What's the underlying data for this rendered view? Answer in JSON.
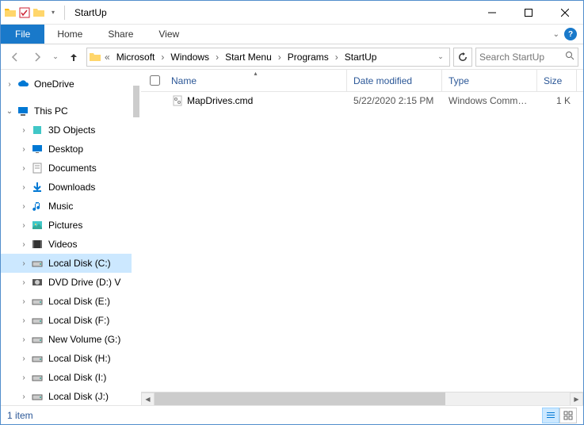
{
  "window": {
    "title": "StartUp"
  },
  "ribbon": {
    "file": "File",
    "tabs": [
      "Home",
      "Share",
      "View"
    ]
  },
  "breadcrumbs": [
    "Microsoft",
    "Windows",
    "Start Menu",
    "Programs",
    "StartUp"
  ],
  "search": {
    "placeholder": "Search StartUp"
  },
  "nav": {
    "onedrive": "OneDrive",
    "thispc": "This PC",
    "items": [
      "3D Objects",
      "Desktop",
      "Documents",
      "Downloads",
      "Music",
      "Pictures",
      "Videos",
      "Local Disk (C:)",
      "DVD Drive (D:) V",
      "Local Disk (E:)",
      "Local Disk (F:)",
      "New Volume (G:)",
      "Local Disk (H:)",
      "Local Disk (I:)",
      "Local Disk (J:)"
    ],
    "selected_index": 7
  },
  "columns": {
    "name": "Name",
    "date": "Date modified",
    "type": "Type",
    "size": "Size"
  },
  "files": [
    {
      "name": "MapDrives.cmd",
      "date": "5/22/2020 2:15 PM",
      "type": "Windows Comma...",
      "size": "1 K"
    }
  ],
  "status": {
    "count": "1 item"
  }
}
